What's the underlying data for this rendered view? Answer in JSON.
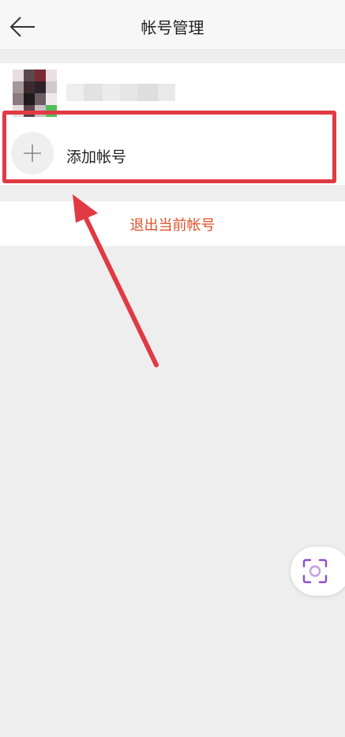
{
  "header": {
    "title": "帐号管理"
  },
  "account": {
    "name": "",
    "avatar_colors": [
      "#e8dde0",
      "#5a4a4e",
      "#7b2a34",
      "#eadfe3",
      "#a4989c",
      "#3d2a2e",
      "#2d2227",
      "#d3c8cc",
      "#8a7c80",
      "#1f1a1c",
      "#6b5d61",
      "#f0e8ea",
      "#e6dcdf",
      "#5c4448",
      "#c7c0c3",
      "#4fbf5a"
    ]
  },
  "add_account": {
    "label": "添加帐号"
  },
  "logout": {
    "label": "退出当前帐号"
  },
  "colors": {
    "highlight": "#e03a44",
    "arrow": "#e03a44",
    "logout_text": "#e0502a",
    "scan_icon": "#8b4fcf"
  }
}
